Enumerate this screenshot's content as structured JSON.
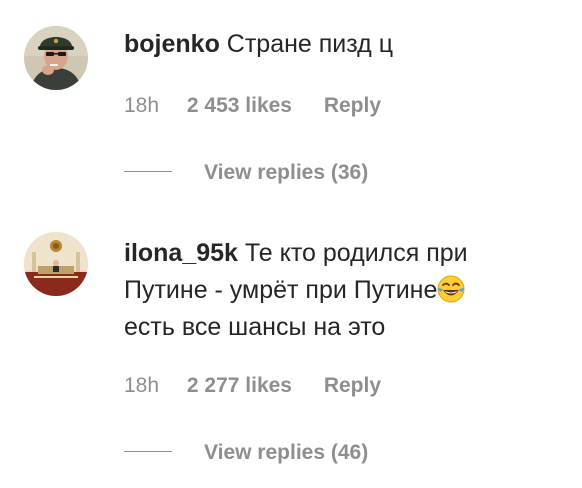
{
  "comments": [
    {
      "username": "bojenko",
      "text": "Стране пизд  ц",
      "time": "18h",
      "likes": "2 453 likes",
      "reply": "Reply",
      "view_replies": "View replies (36)",
      "avatar_icon": "user-avatar-cap"
    },
    {
      "username": "ilona_95k",
      "text_line1": "Те кто родился при",
      "text_line2": "Путине - умрёт при Путине",
      "text_line3": "есть все шансы на это",
      "emoji": "face-with-tears-of-joy",
      "time": "18h",
      "likes": "2 277 likes",
      "reply": "Reply",
      "view_replies": "View replies (46)",
      "avatar_icon": "user-avatar-hall"
    }
  ],
  "colors": {
    "text": "#262626",
    "secondary": "#8e8e8e",
    "background": "#ffffff"
  }
}
